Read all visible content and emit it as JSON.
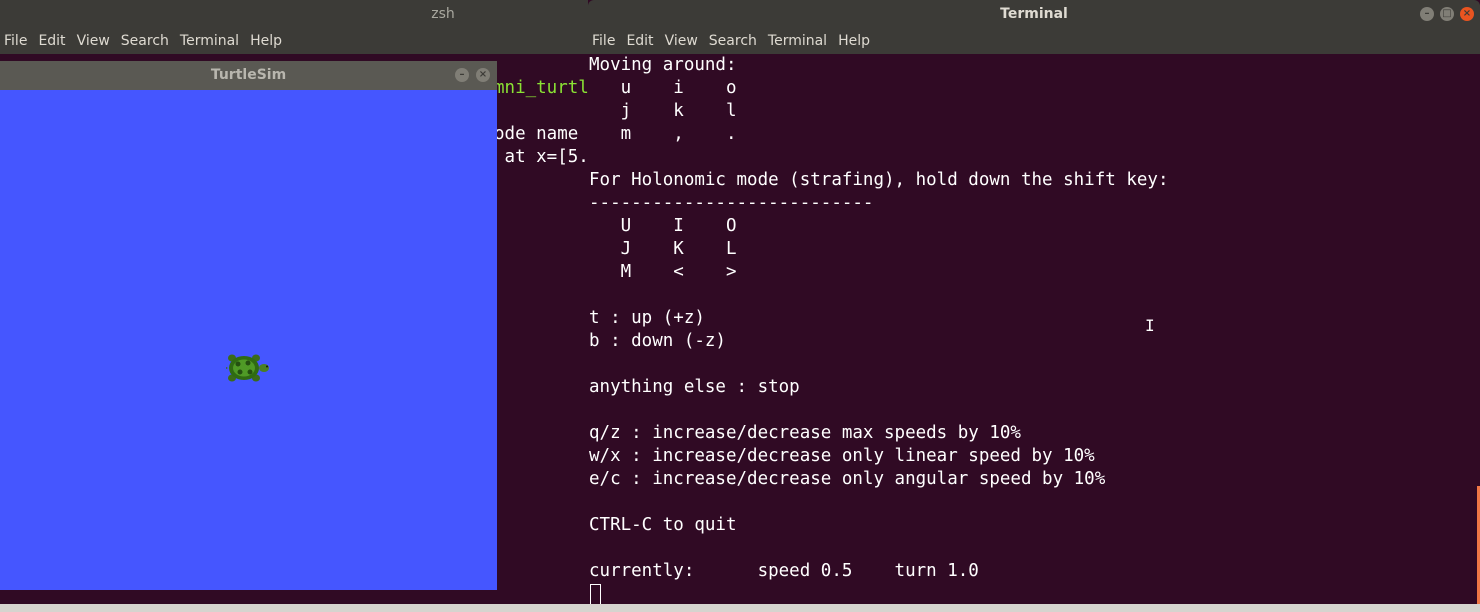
{
  "zsh": {
    "title": "zsh",
    "menu": [
      "File",
      "Edit",
      "View",
      "Search",
      "Terminal",
      "Help"
    ],
    "partial_lines": [
      "mni_turtl",
      "ode name",
      " at x=[5."
    ]
  },
  "turtlesim": {
    "title": "TurtleSim",
    "background_color": "#4556ff"
  },
  "terminal": {
    "title": "Terminal",
    "menu": [
      "File",
      "Edit",
      "View",
      "Search",
      "Terminal",
      "Help"
    ],
    "lines": [
      "Moving around:",
      "   u    i    o",
      "   j    k    l",
      "   m    ,    .",
      "",
      "For Holonomic mode (strafing), hold down the shift key:",
      "---------------------------",
      "   U    I    O",
      "   J    K    L",
      "   M    <    >",
      "",
      "t : up (+z)",
      "b : down (-z)",
      "",
      "anything else : stop",
      "",
      "q/z : increase/decrease max speeds by 10%",
      "w/x : increase/decrease only linear speed by 10%",
      "e/c : increase/decrease only angular speed by 10%",
      "",
      "CTRL-C to quit",
      "",
      "currently:\tspeed 0.5\tturn 1.0"
    ],
    "colors": {
      "background": "#300a24",
      "text": "#ffffff",
      "accent": "#e95420"
    }
  },
  "icons": [
    "minimize-icon",
    "maximize-icon",
    "close-icon",
    "turtle-icon",
    "text-cursor-icon"
  ]
}
